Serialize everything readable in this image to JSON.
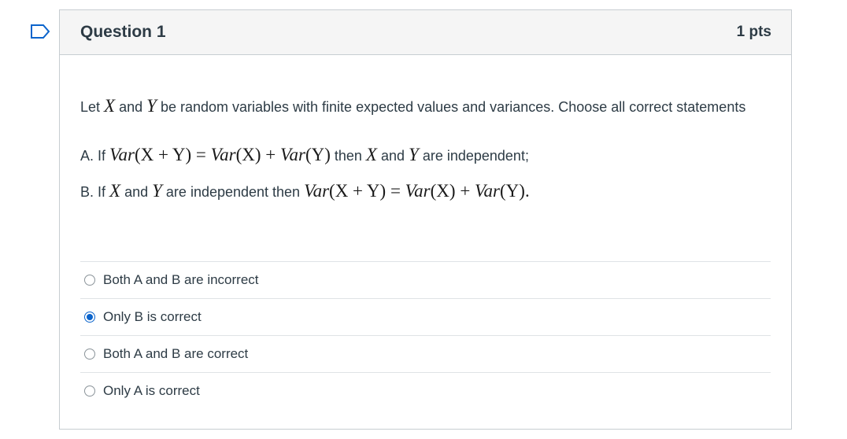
{
  "question": {
    "title": "Question 1",
    "points": "1 pts",
    "prompt": {
      "t1": "Let ",
      "x": "X",
      "t2": " and ",
      "y": "Y",
      "t3": " be random variables with finite expected values and variances. Choose all correct statements"
    },
    "statement_a": {
      "prefix": "A. If ",
      "var1": "Var",
      "lhs_args": "(X + Y)",
      "eq": " = ",
      "var2": "Var",
      "arg2": "(X)",
      "plus": " + ",
      "var3": "Var",
      "arg3": "(Y)",
      "then": " then ",
      "x": "X",
      "and": " and ",
      "y": "Y",
      "suffix": " are independent;"
    },
    "statement_b": {
      "prefix": "B. If ",
      "x": "X",
      "and": " and ",
      "y": "Y",
      "mid": " are independent then ",
      "var1": "Var",
      "lhs_args": "(X + Y)",
      "eq": " = ",
      "var2": "Var",
      "arg2": "(X)",
      "plus": " + ",
      "var3": "Var",
      "arg3": "(Y)",
      "suffix": "."
    },
    "answers": [
      {
        "label": "Both A and B are incorrect",
        "selected": false
      },
      {
        "label": "Only B is correct",
        "selected": true
      },
      {
        "label": "Both A and B are correct",
        "selected": false
      },
      {
        "label": "Only A is correct",
        "selected": false
      }
    ],
    "selected_color": "#0b64cc"
  }
}
